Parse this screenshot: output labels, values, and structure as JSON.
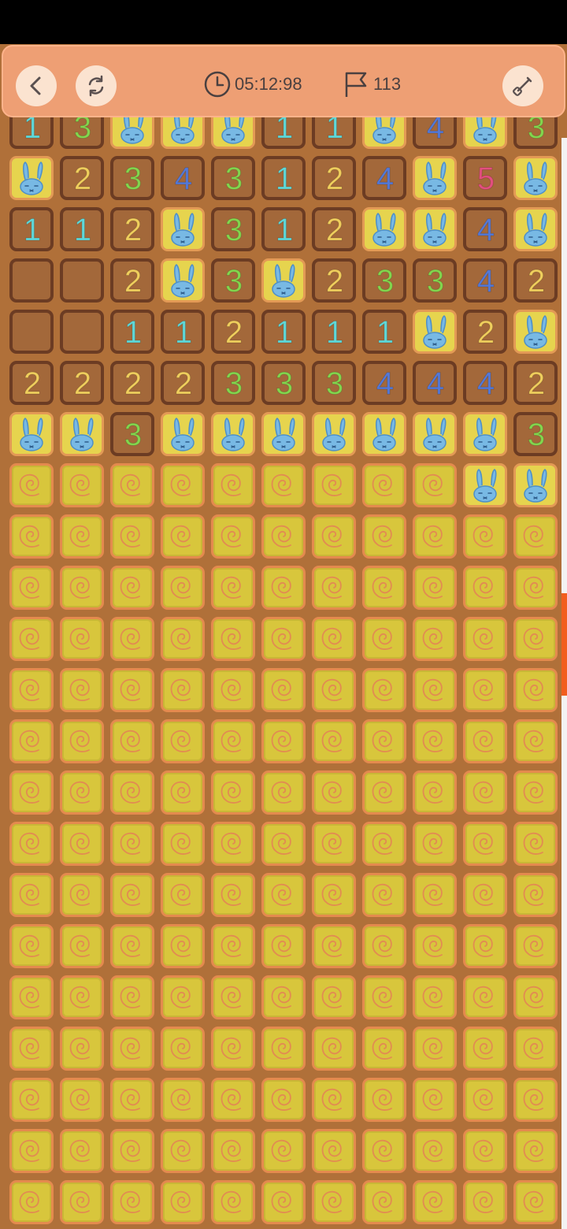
{
  "toolbar": {
    "timer": "05:12:98",
    "flag_count": "113",
    "back_icon": "chevron-left-icon",
    "restart_icon": "refresh-icon",
    "shovel_icon": "shovel-icon"
  },
  "colors": {
    "1": "#5fd8d8",
    "2": "#f1cf5d",
    "3": "#83d64e",
    "4": "#5579d7",
    "5": "#e44f7f"
  },
  "board": {
    "rows": [
      [
        "1",
        "3",
        "B",
        "B",
        "B",
        "1",
        "1",
        "B",
        "4",
        "B",
        "3"
      ],
      [
        "B",
        "2",
        "3",
        "4",
        "3",
        "1",
        "2",
        "4",
        "B",
        "5",
        "B"
      ],
      [
        "1",
        "1",
        "2",
        "B",
        "3",
        "1",
        "2",
        "B",
        "B",
        "4",
        "B"
      ],
      [
        "",
        "",
        "2",
        "B",
        "3",
        "B",
        "2",
        "3",
        "3",
        "4",
        "2"
      ],
      [
        "",
        "",
        "1",
        "1",
        "2",
        "1",
        "1",
        "1",
        "B",
        "2",
        "B"
      ],
      [
        "2",
        "2",
        "2",
        "2",
        "3",
        "3",
        "3",
        "4",
        "4",
        "4",
        "2"
      ],
      [
        "B",
        "B",
        "3",
        "B",
        "B",
        "B",
        "B",
        "B",
        "B",
        "B",
        "3"
      ],
      [
        "H",
        "H",
        "H",
        "H",
        "H",
        "H",
        "H",
        "H",
        "H",
        "B",
        "B"
      ],
      [
        "H",
        "H",
        "H",
        "H",
        "H",
        "H",
        "H",
        "H",
        "H",
        "H",
        "H"
      ],
      [
        "H",
        "H",
        "H",
        "H",
        "H",
        "H",
        "H",
        "H",
        "H",
        "H",
        "H"
      ],
      [
        "H",
        "H",
        "H",
        "H",
        "H",
        "H",
        "H",
        "H",
        "H",
        "H",
        "H"
      ],
      [
        "H",
        "H",
        "H",
        "H",
        "H",
        "H",
        "H",
        "H",
        "H",
        "H",
        "H"
      ],
      [
        "H",
        "H",
        "H",
        "H",
        "H",
        "H",
        "H",
        "H",
        "H",
        "H",
        "H"
      ],
      [
        "H",
        "H",
        "H",
        "H",
        "H",
        "H",
        "H",
        "H",
        "H",
        "H",
        "H"
      ],
      [
        "H",
        "H",
        "H",
        "H",
        "H",
        "H",
        "H",
        "H",
        "H",
        "H",
        "H"
      ],
      [
        "H",
        "H",
        "H",
        "H",
        "H",
        "H",
        "H",
        "H",
        "H",
        "H",
        "H"
      ],
      [
        "H",
        "H",
        "H",
        "H",
        "H",
        "H",
        "H",
        "H",
        "H",
        "H",
        "H"
      ],
      [
        "H",
        "H",
        "H",
        "H",
        "H",
        "H",
        "H",
        "H",
        "H",
        "H",
        "H"
      ],
      [
        "H",
        "H",
        "H",
        "H",
        "H",
        "H",
        "H",
        "H",
        "H",
        "H",
        "H"
      ],
      [
        "H",
        "H",
        "H",
        "H",
        "H",
        "H",
        "H",
        "H",
        "H",
        "H",
        "H"
      ],
      [
        "H",
        "H",
        "H",
        "H",
        "H",
        "H",
        "H",
        "H",
        "H",
        "H",
        "H"
      ],
      [
        "H",
        "H",
        "H",
        "H",
        "H",
        "H",
        "H",
        "H",
        "H",
        "H",
        "H"
      ]
    ]
  }
}
